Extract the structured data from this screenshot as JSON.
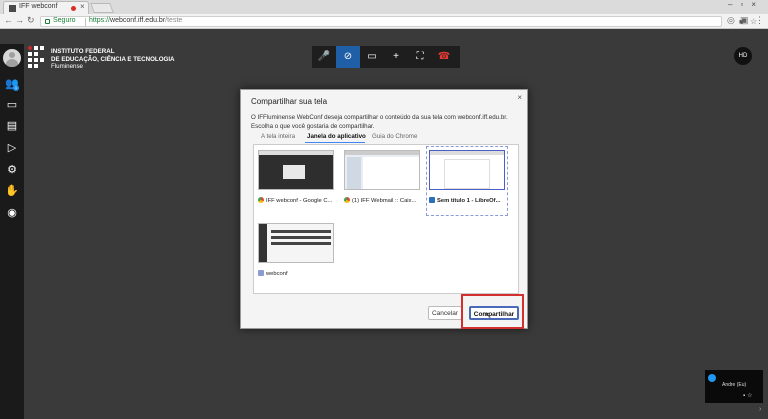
{
  "browser": {
    "tab_title": "IFF webconf",
    "secure_label": "Seguro",
    "url_scheme": "https://",
    "url_host": "webconf.iff.edu.br",
    "url_path": "/teste"
  },
  "header": {
    "institution_line1": "INSTITUTO FEDERAL",
    "institution_line2": "DE EDUCAÇÃO, CIÊNCIA E TECNOLOGIA",
    "institution_line3": "Fluminense",
    "quality_badge": "HD"
  },
  "sidebar": {
    "participants_badge": "1",
    "items": [
      {
        "icon": "participants-icon"
      },
      {
        "icon": "chat-icon"
      },
      {
        "icon": "document-icon"
      },
      {
        "icon": "play-icon"
      },
      {
        "icon": "settings-icon"
      },
      {
        "icon": "raise-hand-icon"
      },
      {
        "icon": "eye-icon"
      }
    ]
  },
  "toolbar": {
    "buttons": [
      "microphone-icon",
      "camera-off-icon",
      "screen-share-icon",
      "invite-icon",
      "fullscreen-icon",
      "hangup-icon"
    ]
  },
  "modal": {
    "title": "Compartilhar sua tela",
    "description": "O IFFluminense WebConf deseja compartilhar o conteúdo da sua tela com webconf.iff.edu.br. Escolha o que você gostaria de compartilhar.",
    "tabs": [
      "A tela inteira",
      "Janela do aplicativo",
      "Guia do Chrome"
    ],
    "selected_tab": "Janela do aplicativo",
    "windows": [
      {
        "label": "IFF webconf - Google C..."
      },
      {
        "label": "(1) IFF Webmail :: Caix..."
      },
      {
        "label": "Sem título 1 - LibreOf..."
      },
      {
        "label": "webconf"
      }
    ],
    "cancel_label": "Cancelar",
    "share_label": "Compartilhar"
  },
  "selfview": {
    "name": "Andre (Eu)"
  },
  "colors": {
    "accent": "#1f5fa8",
    "highlight": "#d32f2f",
    "hangup": "#e53935"
  }
}
